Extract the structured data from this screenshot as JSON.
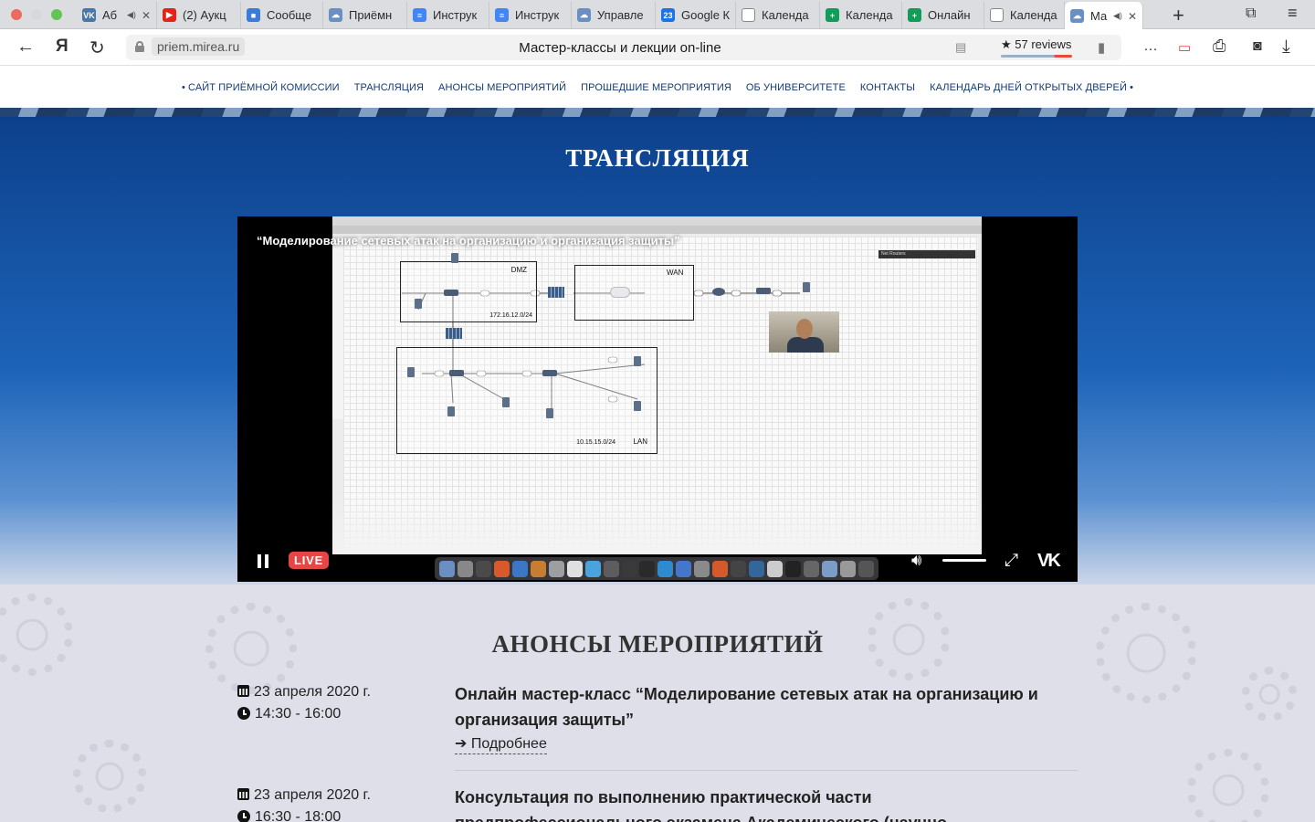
{
  "browser": {
    "tabs": [
      {
        "title": "Аб",
        "icon": "vk-favicon",
        "color": "#4a76a8",
        "glyph": "VK",
        "sound": true
      },
      {
        "title": "(2) Аукц",
        "icon": "youtube-favicon",
        "color": "#e62117",
        "glyph": "▶"
      },
      {
        "title": "Сообще",
        "icon": "chat-favicon",
        "color": "#3d7bd8",
        "glyph": "■"
      },
      {
        "title": "Приёмн",
        "icon": "cloud-favicon",
        "color": "#6a8fc2",
        "glyph": "☁"
      },
      {
        "title": "Инструк",
        "icon": "docs-favicon",
        "color": "#4285f4",
        "glyph": "≡"
      },
      {
        "title": "Инструк",
        "icon": "docs-favicon",
        "color": "#4285f4",
        "glyph": "≡"
      },
      {
        "title": "Управле",
        "icon": "cloud-favicon",
        "color": "#6a8fc2",
        "glyph": "☁"
      },
      {
        "title": "Google К",
        "icon": "calendar-favicon",
        "color": "#1a73e8",
        "glyph": "23"
      },
      {
        "title": "Календа",
        "icon": "page-favicon",
        "color": "#ffffff",
        "glyph": ""
      },
      {
        "title": "Календа",
        "icon": "sheets-favicon",
        "color": "#0f9d58",
        "glyph": "+"
      },
      {
        "title": "Онлайн",
        "icon": "sheets-favicon",
        "color": "#0f9d58",
        "glyph": "+"
      },
      {
        "title": "Календа",
        "icon": "page-favicon",
        "color": "#ffffff",
        "glyph": ""
      },
      {
        "title": "Ма",
        "icon": "cloud-favicon",
        "color": "#6a8fc2",
        "glyph": "☁",
        "sound": true,
        "active": true
      }
    ],
    "url": "priem.mirea.ru",
    "page_title": "Мастер-классы и лекции on-line",
    "reviews": "★ 57 reviews"
  },
  "site_nav": [
    "• САЙТ ПРИЁМНОЙ КОМИССИИ",
    "ТРАНСЛЯЦИЯ",
    "АНОНСЫ МЕРОПРИЯТИЙ",
    "ПРОШЕДШИЕ МЕРОПРИЯТИЯ",
    "ОБ УНИВЕРСИТЕТЕ",
    "КОНТАКТЫ",
    "КАЛЕНДАРЬ ДНЕЙ ОТКРЫТЫХ ДВЕРЕЙ •"
  ],
  "broadcast": {
    "heading": "ТРАНСЛЯЦИЯ",
    "video_title": "“Моделирование сетевых атак на организацию и организация защиты”",
    "live_label": "LIVE",
    "diagram": {
      "dmz_label": "DMZ",
      "dmz_net": "172.16.12.0/24",
      "wan_label": "WAN",
      "lan_label": "LAN",
      "lan_net": "10.15.15.0/24",
      "panel_label": "Net Routers"
    }
  },
  "announcements": {
    "heading": "АНОНСЫ МЕРОПРИЯТИЙ",
    "events": [
      {
        "date": "23 апреля 2020 г.",
        "time": "14:30 - 16:00",
        "title": "Онлайн мастер-класс “Моделирование сетевых атак на организацию и организация защиты”",
        "more": "Подробнее"
      },
      {
        "date": "23 апреля 2020 г.",
        "time": "16:30 - 18:00",
        "title": "Консультация по выполнению практической части предпрофессионального экзамена Академического (научно-"
      }
    ]
  },
  "colors": {
    "nav_text": "#123a74",
    "hero_top": "#0c3f8a",
    "live_badge": "#e64646"
  }
}
